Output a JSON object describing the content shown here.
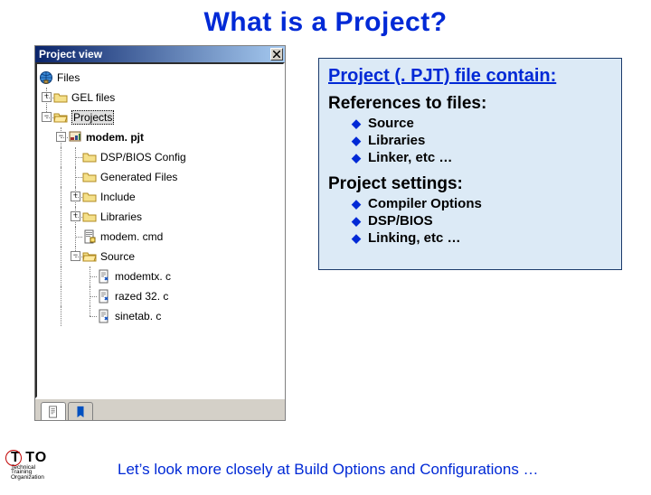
{
  "title": "What is a Project?",
  "window": {
    "title": "Project view",
    "tree": {
      "root": "Files",
      "gel": "GEL files",
      "projects": "Projects",
      "pjt": "modem. pjt",
      "dspbios": "DSP/BIOS Config",
      "genfiles": "Generated Files",
      "include": "Include",
      "libs": "Libraries",
      "cmd": "modem. cmd",
      "source": "Source",
      "src1": "modemtx. c",
      "src2": "razed 32. c",
      "src3": "sinetab. c"
    }
  },
  "info": {
    "heading": "Project (. PJT) file contain:",
    "sec1": "References to files:",
    "sec1_items": {
      "a": "Source",
      "b": "Libraries",
      "c": "Linker, etc …"
    },
    "sec2": "Project settings:",
    "sec2_items": {
      "a": "Compiler Options",
      "b": "DSP/BIOS",
      "c": "Linking, etc …"
    }
  },
  "footer": "Let’s look more closely at Build Options and Configurations …",
  "logo": {
    "abbr": "T TO",
    "line1": "Technical",
    "line2": "Training",
    "line3": "Organization"
  }
}
